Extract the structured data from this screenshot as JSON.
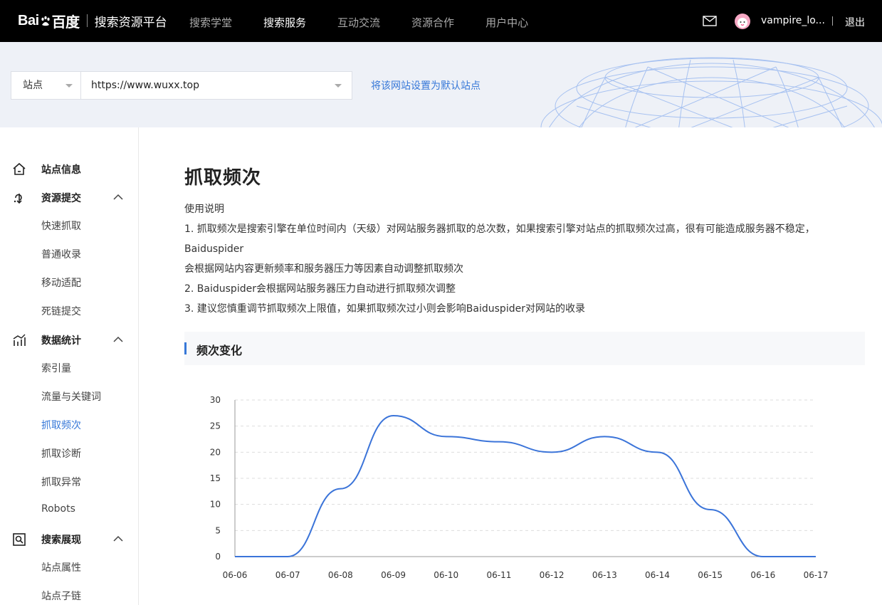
{
  "topnav": {
    "logo_text": "Bai",
    "logo_text2": "百度",
    "platform_title": "搜索资源平台",
    "items": [
      {
        "label": "搜索学堂",
        "active": false
      },
      {
        "label": "搜索服务",
        "active": true
      },
      {
        "label": "互动交流",
        "active": false
      },
      {
        "label": "资源合作",
        "active": false
      },
      {
        "label": "用户中心",
        "active": false
      }
    ],
    "mail_icon": "mail-icon",
    "username": "vampire_lo...",
    "logout": "退出"
  },
  "sitebar": {
    "type_select": "站点",
    "url_value": "https://www.wuxx.top",
    "set_default_link": "将该网站设置为默认站点"
  },
  "sidebar": {
    "groups": [
      {
        "label": "站点信息",
        "icon": "home-icon",
        "expandable": false
      },
      {
        "label": "资源提交",
        "icon": "submit-icon",
        "expandable": true,
        "items": [
          "快速抓取",
          "普通收录",
          "移动适配",
          "死链提交"
        ]
      },
      {
        "label": "数据统计",
        "icon": "stats-icon",
        "expandable": true,
        "items": [
          "索引量",
          "流量与关键词",
          "抓取频次",
          "抓取诊断",
          "抓取异常",
          "Robots"
        ]
      },
      {
        "label": "搜索展现",
        "icon": "search-display-icon",
        "expandable": true,
        "items": [
          "站点属性",
          "站点子链"
        ]
      }
    ],
    "active_item": "抓取频次",
    "accent": "#3778d8"
  },
  "main": {
    "title": "抓取频次",
    "desc_heading": "使用说明",
    "desc_lines": [
      "1. 抓取频次是搜索引擎在单位时间内（天级）对网站服务器抓取的总次数，如果搜索引擎对站点的抓取频次过高，很有可能造成服务器不稳定，Baiduspider",
      "会根据网站内容更新频率和服务器压力等因素自动调整抓取频次",
      "2. Baiduspider会根据网站服务器压力自动进行抓取频次调整",
      "3. 建议您慎重调节抓取频次上限值，如果抓取频次过小则会影响Baiduspider对网站的收录"
    ],
    "section_title": "频次变化"
  },
  "chart_data": {
    "type": "line",
    "x": [
      "06-06",
      "06-07",
      "06-08",
      "06-09",
      "06-10",
      "06-11",
      "06-12",
      "06-13",
      "06-14",
      "06-15",
      "06-16",
      "06-17"
    ],
    "series": [
      {
        "values": [
          0,
          0,
          13,
          27,
          23,
          22,
          20,
          23,
          20,
          9,
          0,
          0
        ],
        "color": "#3b74d9"
      }
    ],
    "ylim": [
      0,
      30
    ],
    "yticks": [
      0,
      5,
      10,
      15,
      20,
      25,
      30
    ],
    "grid": true,
    "smooth": true
  }
}
